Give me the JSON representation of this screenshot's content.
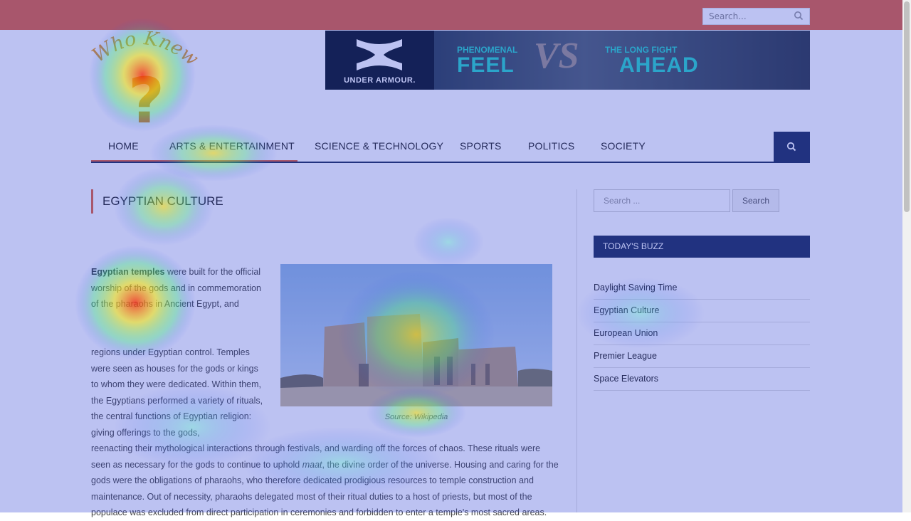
{
  "top_bar": {
    "search_placeholder": "Search...",
    "color": "#e2603a"
  },
  "logo": {
    "text": "Who Knew",
    "symbol": "?"
  },
  "banner_ad": {
    "brand": "UNDER ARMOUR.",
    "left_small": "PHENOMENAL",
    "left_big": "FEEL",
    "center": "VS",
    "right_small": "THE LONG FIGHT",
    "right_big": "AHEAD"
  },
  "nav": {
    "items": [
      "HOME",
      "ARTS & ENTERTAINMENT",
      "SCIENCE & TECHNOLOGY",
      "SPORTS",
      "POLITICS",
      "SOCIETY"
    ],
    "search_icon": "search-icon"
  },
  "article": {
    "title": "EGYPTIAN CULTURE",
    "lead_bold": "Egyptian temples",
    "para1_rest": " were built for the official worship of the gods and in commemoration of the pharaohs in Ancient Egypt, and",
    "para2a": "regions under Egyptian control. Temples were seen as houses for the gods or kings to whom they were dedicated. Within them, the Egyptians performed a variety of rituals, the central functions of Egyptian religion: giving offerings to the gods,",
    "para2b_before": "reenacting their mythological interactions through festivals, and warding off the forces of chaos. These rituals were seen as necessary for the gods to continue to uphold ",
    "para2b_italic": "maat",
    "para2b_after": ", the divine order of the universe. Housing and caring for the gods were the obligations of pharaohs, who therefore dedicated prodigious resources to temple construction and maintenance. Out of necessity, pharaohs delegated most of their ritual duties to a host of priests, but most of the populace was excluded from direct participation in ceremonies and forbidden to enter a temple's most sacred areas.",
    "image_caption": "Source: Wikipedia"
  },
  "sidebar": {
    "search_placeholder": "Search ...",
    "search_button": "Search",
    "buzz_heading": "TODAY'S BUZZ",
    "buzz_items": [
      "Daylight Saving Time",
      "Egyptian Culture",
      "European Union",
      "Premier League",
      "Space Elevators"
    ]
  },
  "colors": {
    "accent": "#e2603a",
    "navy": "#1b2c58"
  }
}
